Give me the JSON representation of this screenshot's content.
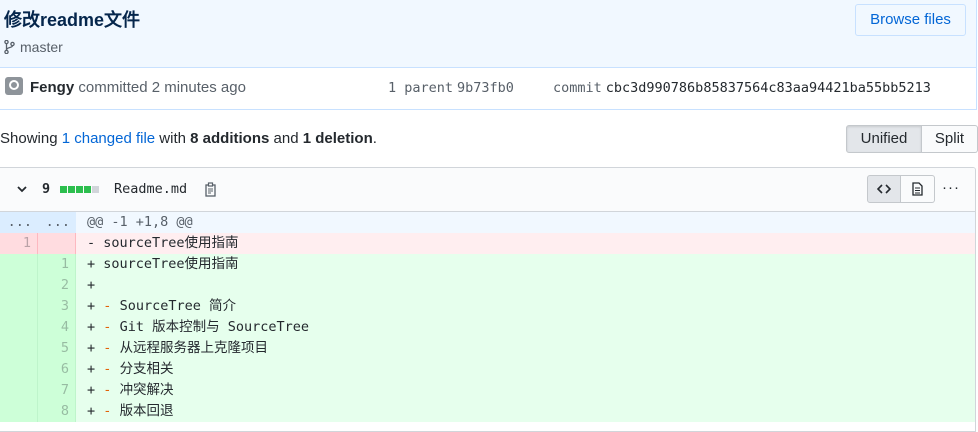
{
  "commit": {
    "title": "修改readme文件",
    "branch": "master",
    "browse_label": "Browse files",
    "author": "Fengy",
    "action": "committed",
    "time": "2 minutes ago",
    "parent_label": "1 parent",
    "parent_sha": "9b73fb0",
    "commit_label": "commit",
    "commit_sha": "cbc3d990786b85837564c83aa94421ba55bb5213"
  },
  "toc": {
    "showing": "Showing",
    "changed_files": "1 changed file",
    "with": "with",
    "additions": "8 additions",
    "and": "and",
    "deletions": "1 deletion",
    "period": "."
  },
  "view_toggle": {
    "unified": "Unified",
    "split": "Split",
    "selected": "Unified"
  },
  "file": {
    "change_count": "9",
    "diffstat": {
      "additions": 4,
      "neutral": 1
    },
    "name": "Readme.md",
    "more": "···"
  },
  "diff": {
    "hunk": {
      "old_dots": "...",
      "new_dots": "...",
      "header": "@@ -1 +1,8 @@"
    },
    "lines": [
      {
        "type": "del",
        "old": "1",
        "new": "",
        "marker": "-",
        "prefix": "",
        "text": "sourceTree使用指南"
      },
      {
        "type": "add",
        "old": "",
        "new": "1",
        "marker": "+",
        "prefix": "",
        "text": "sourceTree使用指南"
      },
      {
        "type": "add",
        "old": "",
        "new": "2",
        "marker": "+",
        "prefix": "",
        "text": ""
      },
      {
        "type": "add",
        "old": "",
        "new": "3",
        "marker": "+",
        "prefix": "-",
        "text": "SourceTree 简介"
      },
      {
        "type": "add",
        "old": "",
        "new": "4",
        "marker": "+",
        "prefix": "-",
        "text": "Git 版本控制与 SourceTree"
      },
      {
        "type": "add",
        "old": "",
        "new": "5",
        "marker": "+",
        "prefix": "-",
        "text": "从远程服务器上克隆项目"
      },
      {
        "type": "add",
        "old": "",
        "new": "6",
        "marker": "+",
        "prefix": "-",
        "text": "分支相关"
      },
      {
        "type": "add",
        "old": "",
        "new": "7",
        "marker": "+",
        "prefix": "-",
        "text": "冲突解决"
      },
      {
        "type": "add",
        "old": "",
        "new": "8",
        "marker": "+",
        "prefix": "-",
        "text": "版本回退"
      }
    ]
  },
  "colors": {
    "header_bg": "#f1f8ff",
    "link": "#0366d6",
    "add_bg": "#e6ffed",
    "del_bg": "#ffeef0",
    "diffstat_add": "#2cbe4e",
    "list_dash": "#e36209"
  }
}
